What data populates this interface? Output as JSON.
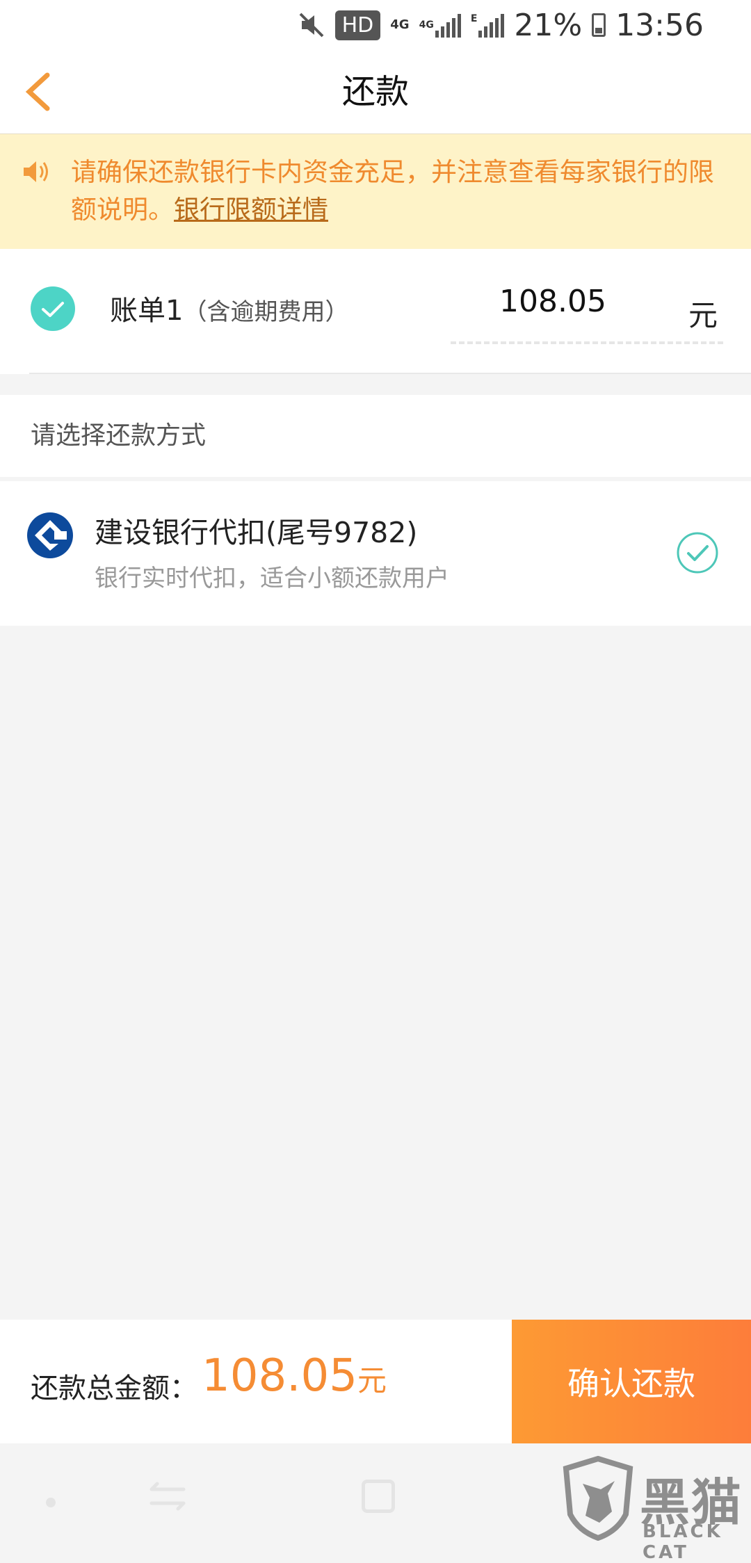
{
  "status_bar": {
    "hd_badge": "HD",
    "net1": "4G",
    "net2": "4G",
    "net3": "E",
    "battery_percent": "21%",
    "time": "13:56"
  },
  "header": {
    "title": "还款"
  },
  "notice": {
    "text": "请确保还款银行卡内资金充足，并注意查看每家银行的限额说明。",
    "link": "银行限额详情"
  },
  "bill": {
    "label": "账单1",
    "note": "（含逾期费用）",
    "amount": "108.05",
    "unit": "元"
  },
  "payment_section": {
    "label": "请选择还款方式"
  },
  "payment_method": {
    "name": "建设银行代扣(尾号9782)",
    "description": "银行实时代扣，适合小额还款用户"
  },
  "footer": {
    "total_label": "还款总金额：",
    "total_amount": "108.05",
    "total_unit": "元",
    "confirm_label": "确认还款"
  },
  "watermark": {
    "text": "黑猫",
    "sub": "BLACK CAT"
  },
  "colors": {
    "accent_orange": "#f58c34",
    "teal_check": "#4dd4c6",
    "notice_bg": "#fef3c8",
    "bank_blue": "#0d4a9c"
  },
  "icons": [
    "back-arrow-icon",
    "speaker-icon",
    "check-filled-icon",
    "ccb-bank-logo-icon",
    "check-outline-icon"
  ]
}
